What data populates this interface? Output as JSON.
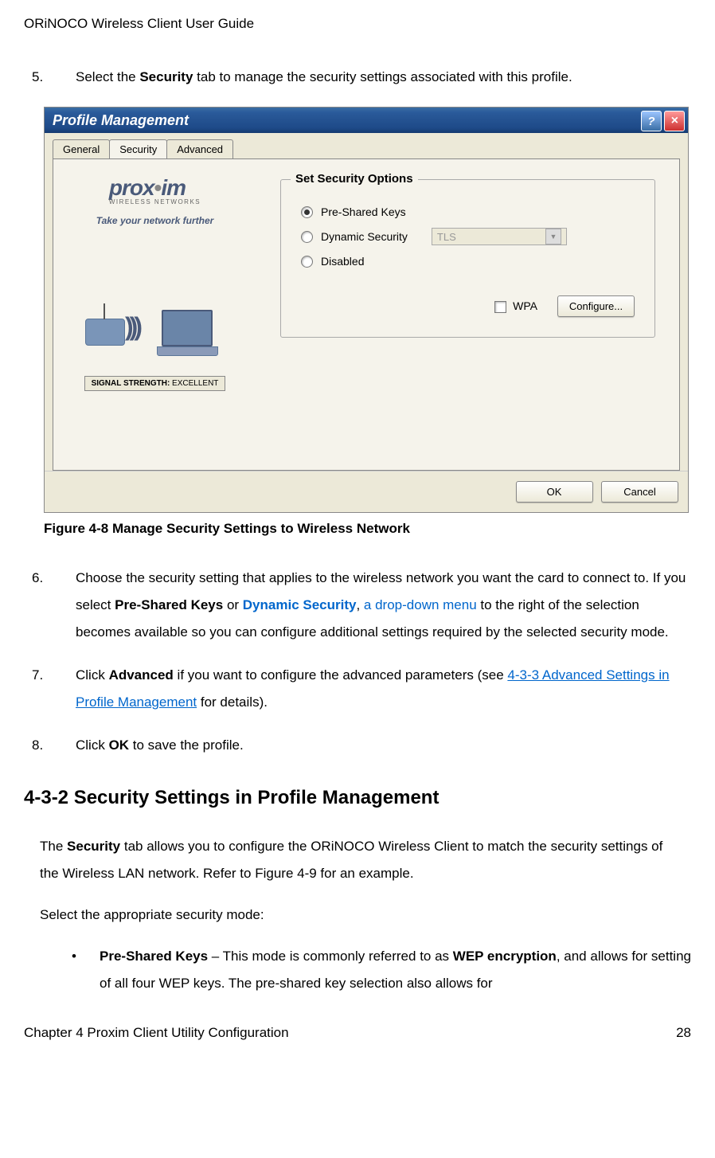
{
  "header": "ORiNOCO Wireless Client User Guide",
  "step5": {
    "num": "5.",
    "pre": "Select the ",
    "bold": "Security",
    "post": " tab to manage the security settings associated with this profile."
  },
  "dialog": {
    "title": "Profile Management",
    "helpBtn": "?",
    "closeBtn": "×",
    "tabs": {
      "general": "General",
      "security": "Security",
      "advanced": "Advanced"
    },
    "logo": {
      "brand": "prox",
      "brand2": "im",
      "sub": "WIRELESS NETWORKS"
    },
    "tagline": "Take your network further",
    "signal": {
      "label": "SIGNAL STRENGTH:",
      "value": " EXCELLENT"
    },
    "group": {
      "title": "Set Security Options",
      "opt1": "Pre-Shared Keys",
      "opt2": "Dynamic Security",
      "opt3": "Disabled",
      "dropdown": "TLS",
      "wpa": "WPA",
      "configure": "Configure..."
    },
    "okBtn": "OK",
    "cancelBtn": "Cancel"
  },
  "figureCaption": "Figure 4-8  Manage Security Settings to Wireless Network",
  "step6": {
    "num": "6.",
    "p1": "Choose the security setting that applies to the wireless network you want the card to connect to. If you select ",
    "b1": "Pre-Shared Keys",
    "p2": " or ",
    "b2": "Dynamic Security",
    "p3": ", ",
    "blue": "a drop-down menu",
    "p4": " to the right of the selection becomes available so you can configure additional settings required by the selected security mode."
  },
  "step7": {
    "num": "7.",
    "p1": "Click ",
    "b1": "Advanced",
    "p2": " if you want to configure the advanced parameters (see ",
    "link": "4-3-3 Advanced Settings in Profile Management",
    "p3": " for details)."
  },
  "step8": {
    "num": "8.",
    "p1": "Click ",
    "b1": "OK",
    "p2": " to save the profile."
  },
  "sectionHeading": "4-3-2 Security Settings in Profile Management",
  "para1": {
    "p1": "The ",
    "b1": "Security",
    "p2": " tab allows you to configure the ORiNOCO Wireless Client to match the security settings of the Wireless LAN network. Refer to Figure 4-9 for an example."
  },
  "para2": "Select the appropriate security mode:",
  "bullet1": {
    "b1": "Pre-Shared Keys",
    "p1": " – This mode is commonly referred to as ",
    "b2": "WEP encryption",
    "p2": ", and allows for setting of all four WEP keys. The pre-shared key selection also allows for"
  },
  "footer": {
    "left": "Chapter 4 Proxim Client Utility Configuration",
    "right": "28"
  }
}
